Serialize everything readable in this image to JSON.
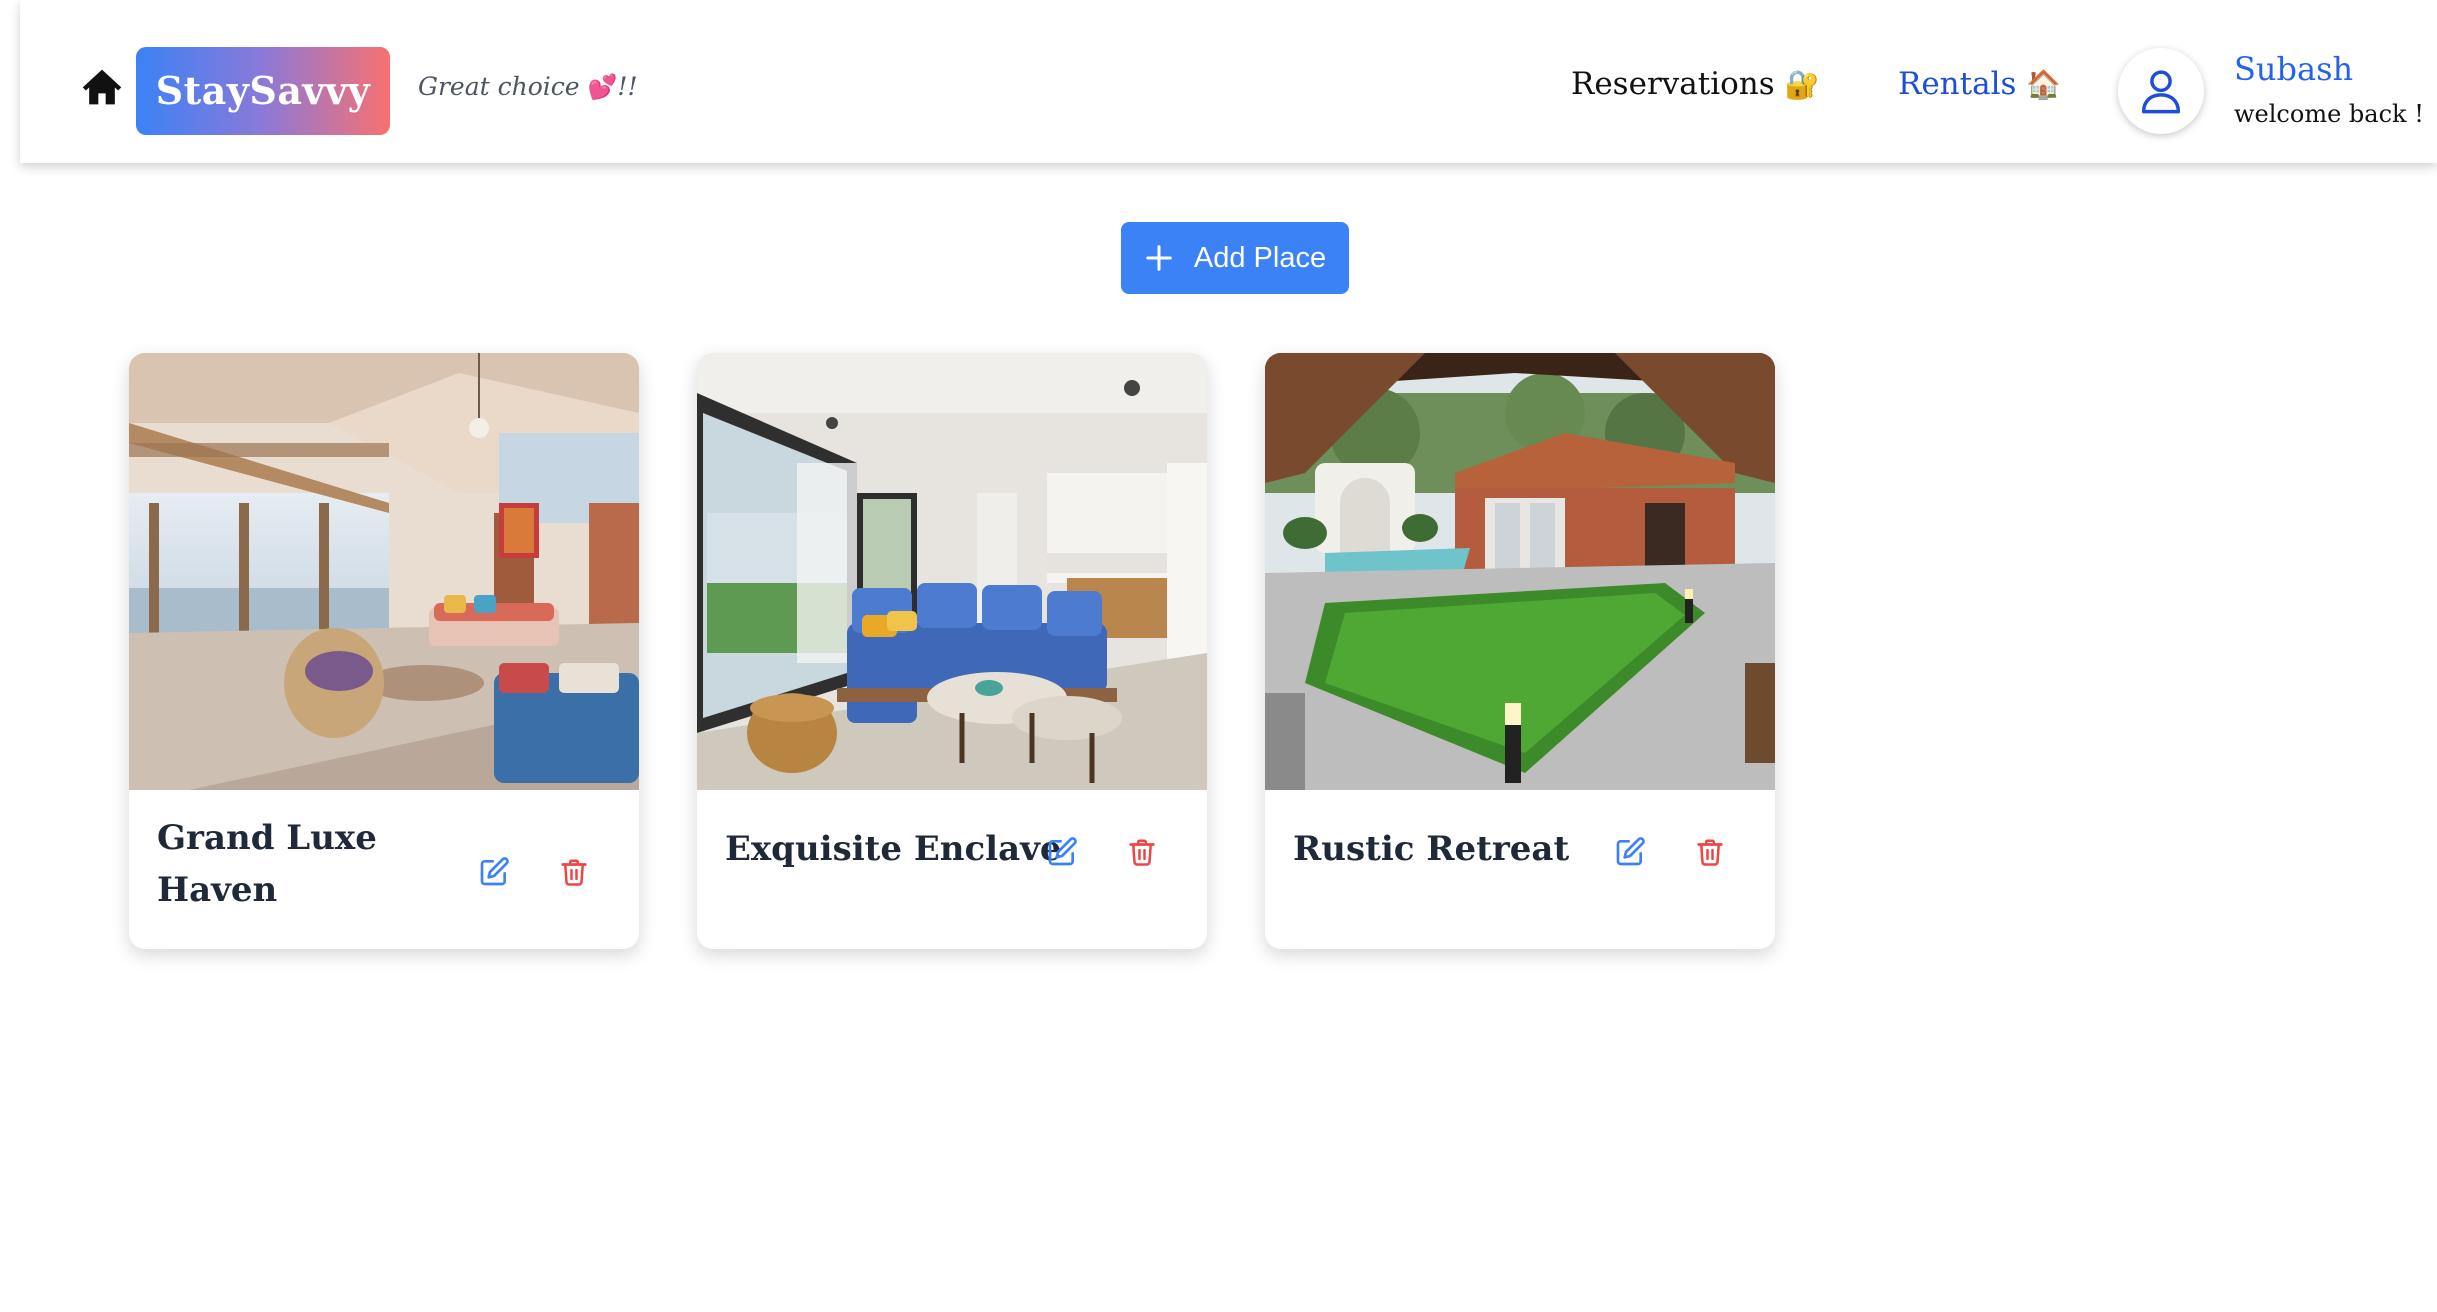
{
  "header": {
    "logo_text": "StaySavvy",
    "tagline": "Great choice",
    "tagline_emoji": "💕",
    "tagline_suffix": "!!",
    "nav": {
      "reservations_label": "Reservations",
      "reservations_emoji": "🔐",
      "rentals_label": "Rentals",
      "rentals_emoji": "🏠"
    },
    "user": {
      "name": "Subash",
      "greeting": "welcome back !"
    }
  },
  "add_place_label": "Add Place",
  "places": [
    {
      "title": "Grand Luxe Haven",
      "image": "living room with sea-view terrace"
    },
    {
      "title": "Exquisite Enclave",
      "image": "modern living room with blue sectional sofa"
    },
    {
      "title": "Rustic Retreat",
      "image": "brick villa courtyard with lawn and pool"
    }
  ],
  "colors": {
    "accent": "#3b82f6",
    "link_active": "#1d4ed8",
    "delete": "#ef4444",
    "logo_gradient_start": "#3b82f6",
    "logo_gradient_end": "#f87171"
  },
  "icons": {
    "home": "home-icon",
    "user": "user-icon",
    "add": "plus-icon",
    "edit": "edit-icon",
    "delete": "trash-icon"
  }
}
